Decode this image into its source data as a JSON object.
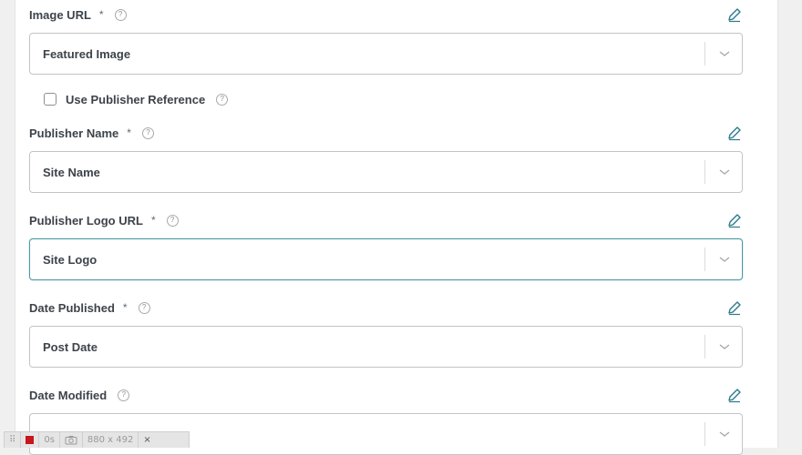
{
  "fields": [
    {
      "label": "Image URL",
      "required": "*",
      "help": "?",
      "value": "Featured Image"
    },
    {
      "label": "Publisher Name",
      "required": "*",
      "help": "?",
      "value": "Site Name"
    },
    {
      "label": "Publisher Logo URL",
      "required": "*",
      "help": "?",
      "value": "Site Logo"
    },
    {
      "label": "Date Published",
      "required": "*",
      "help": "?",
      "value": "Post Date"
    },
    {
      "label": "Date Modified",
      "help": "?",
      "value": ""
    }
  ],
  "checkbox": {
    "label": "Use Publisher Reference",
    "help": "?",
    "checked": false
  },
  "recorder": {
    "time": "0s",
    "dimensions": "880 x 492",
    "close": "×"
  }
}
